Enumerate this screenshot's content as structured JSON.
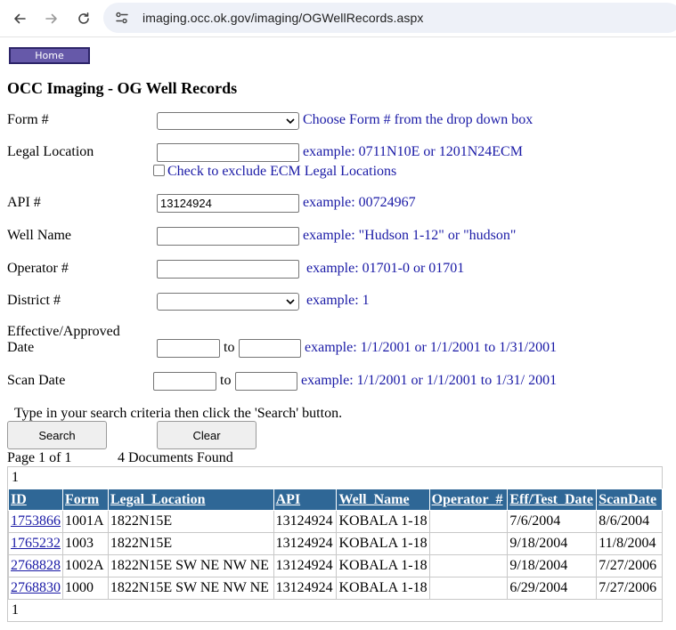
{
  "browser": {
    "url": "imaging.occ.ok.gov/imaging/OGWellRecords.aspx"
  },
  "page": {
    "home_label": "Home",
    "title": "OCC Imaging - OG Well Records"
  },
  "form": {
    "form_no": {
      "label": "Form #",
      "hint": "Choose Form # from the drop down box",
      "value": ""
    },
    "legal_location": {
      "label": "Legal Location",
      "value": "",
      "hint": "example: 0711N10E or 1201N24ECM",
      "exclude_ecm_label": "Check to exclude ECM Legal Locations",
      "exclude_ecm_checked": false
    },
    "api": {
      "label": "API #",
      "value": "13124924",
      "hint": "example: 00724967"
    },
    "well_name": {
      "label": "Well Name",
      "value": "",
      "hint": "example: \"Hudson 1-12\" or \"hudson\""
    },
    "operator": {
      "label": "Operator #",
      "value": "",
      "hint": "example: 01701-0 or 01701"
    },
    "district": {
      "label": "District #",
      "value": "",
      "hint": "example: 1"
    },
    "effective_date": {
      "label_line1": "Effective/Approved",
      "label_line2": "Date",
      "from": "",
      "to_label": "to",
      "to": "",
      "hint": "example: 1/1/2001 or 1/1/2001 to 1/31/2001"
    },
    "scan_date": {
      "label": "Scan Date",
      "from": "",
      "to_label": "to",
      "to": "",
      "hint": "example: 1/1/2001 or 1/1/2001 to 1/31/ 2001"
    },
    "instructions": "Type in your search criteria then click the 'Search' button.",
    "search_label": "Search",
    "clear_label": "Clear"
  },
  "results": {
    "page_info": "Page 1 of 1",
    "found_info": "4 Documents Found",
    "pager_top": "1",
    "pager_bottom": "1",
    "columns": [
      "ID",
      "Form",
      "Legal_Location",
      "API",
      "Well_Name",
      "Operator_#",
      "Eff/Test_Date",
      "ScanDate"
    ],
    "rows": [
      [
        "1753866",
        "1001A",
        "1822N15E",
        "13124924",
        "KOBALA 1-18",
        "",
        "7/6/2004",
        "8/6/2004"
      ],
      [
        "1765232",
        "1003",
        "1822N15E",
        "13124924",
        "KOBALA 1-18",
        "",
        "9/18/2004",
        "11/8/2004"
      ],
      [
        "2768828",
        "1002A",
        "1822N15E SW NE NW NE",
        "13124924",
        "KOBALA 1-18",
        "",
        "9/18/2004",
        "7/27/2006"
      ],
      [
        "2768830",
        "1000",
        "1822N15E SW NE NW NE",
        "13124924",
        "KOBALA 1-18",
        "",
        "6/29/2004",
        "7/27/2006"
      ]
    ]
  },
  "colors": {
    "header_bg": "#2f6796",
    "hint_text": "#1a1aa6",
    "home_bg": "#6659a9"
  },
  "icons": [
    "back-arrow-icon",
    "forward-arrow-icon",
    "reload-icon",
    "site-info-icon",
    "chevron-down-icon"
  ]
}
